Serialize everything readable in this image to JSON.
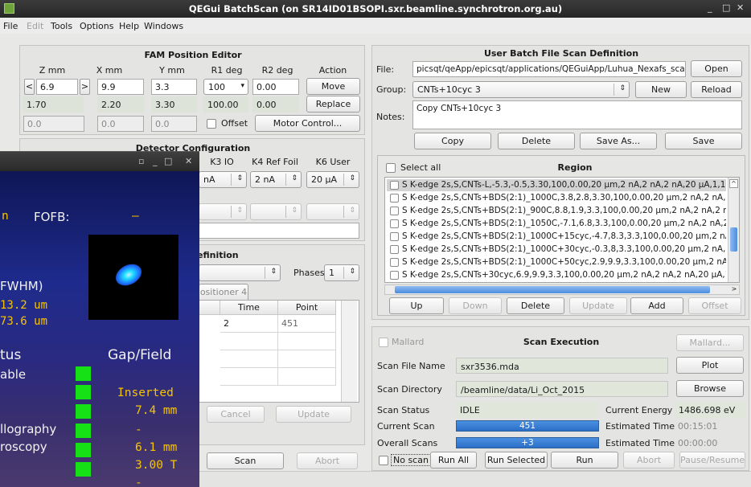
{
  "window": {
    "title": "QEGui BatchScan (on SR14ID01BSOPI.sxr.beamline.synchrotron.org.au)",
    "minimize": "_",
    "maximize": "□",
    "close": "✕"
  },
  "menu": [
    "File",
    "Edit",
    "Tools",
    "Options",
    "Help",
    "Windows"
  ],
  "fam": {
    "title": "FAM Position Editor",
    "headers": [
      "Z mm",
      "X mm",
      "Y mm",
      "R1 deg",
      "R2 deg",
      "Action"
    ],
    "z_input": "6.9",
    "x_input": "9.9",
    "y_input": "3.3",
    "r1_select": "100",
    "r2_input": "0.00",
    "move_label": "Move",
    "readback": [
      "1.70",
      "2.20",
      "3.30",
      "100.00",
      "0.00"
    ],
    "replace_label": "Replace",
    "disabled_values": [
      "0.0",
      "0.0",
      "0.0"
    ],
    "offset_label": "Offset",
    "motor_control_label": "Motor Control..."
  },
  "detector": {
    "title": "Detector Configuration",
    "headers": [
      "K3 IO",
      "K4 Ref Foil",
      "K6 User"
    ],
    "col0_value": "nA",
    "k4_value": "2 nA",
    "k6_value": "20 μA"
  },
  "scan_def": {
    "title_partial": "efinition",
    "phases_label": "Phases",
    "phases_value": "1",
    "tab_label": "ositioner 4",
    "table_headers": [
      "Time",
      "Point"
    ],
    "row_time": "2",
    "row_point": "451",
    "cancel_label": "Cancel",
    "update_label": "Update",
    "scan_label": "Scan",
    "abort_label": "Abort"
  },
  "batch": {
    "title": "User Batch File Scan Definition",
    "file_label": "File:",
    "file_value": "picsqt/qeApp/epicsqt/applications/QEGuiApp/Luhua_Nexafs_scans.xml",
    "open_label": "Open",
    "group_label": "Group:",
    "group_value": "CNTs+10cyc 3",
    "new_label": "New",
    "reload_label": "Reload",
    "notes_label": "Notes:",
    "notes_value": "Copy CNTs+10cyc 3",
    "copy_label": "Copy",
    "delete_label": "Delete",
    "save_as_label": "Save As...",
    "save_label": "Save",
    "select_all_label": "Select all",
    "region_label": "Region",
    "regions": [
      "S K-edge 2s,S,CNTs-L,-5.3,-0.5,3.30,100,0.00,20 μm,2 nA,2 nA,2 nA,20 μA,1,1",
      "S K-edge 2s,S,CNTs+BDS(2:1)_1000C,3.8,2.8,3.30,100,0.00,20 μm,2 nA,2 nA,2 nA,20 μ",
      "S K-edge 2s,S,CNTs+BDS(2:1)_900C,8.8,1.9,3.3,100,0.00,20 μm,2 nA,2 nA,2 nA,20 μA",
      "S K-edge 2s,S,CNTs+BDS(2:1)_1050C,-7.1,6.8,3.3,100,0.00,20 μm,2 nA,2 nA,2 nA,20 μ",
      "S K-edge 2s,S,CNTs+BDS(2:1)_1000C+15cyc,-4.7,8.3,3.3,100,0.00,20 μm,2 nA,2 nA,2 n",
      "S K-edge 2s,S,CNTs+BDS(2:1)_1000C+30cyc,-0.3,8,3.3,100,0.00,20 μm,2 nA,2 nA,2 n",
      "S K-edge 2s,S,CNTs+BDS(2:1)_1000C+50cyc,2.9,9.9,3.3,100,0.00,20 μm,2 nA,2 nA,2 n",
      "S K-edge 2s,S,CNTs+30cyc,6.9,9.9,3.3,100,0.00,20 μm,2 nA,2 nA,2 nA,20 μA,1,1"
    ],
    "up_label": "Up",
    "down_label": "Down",
    "delete2_label": "Delete",
    "update_label": "Update",
    "add_label": "Add",
    "offset_label": "Offset"
  },
  "execution": {
    "mallard_chk_label": "Mallard",
    "title": "Scan Execution",
    "mallard_btn_label": "Mallard...",
    "file_name_label": "Scan File Name",
    "file_name_value": "sxr3536.mda",
    "plot_label": "Plot",
    "directory_label": "Scan Directory",
    "directory_value": "/beamline/data/Li_Oct_2015",
    "browse_label": "Browse",
    "status_label": "Scan Status",
    "status_value": "IDLE",
    "energy_label": "Current Energy",
    "energy_value": "1486.698 eV",
    "current_scan_label": "Current Scan",
    "current_scan_value": "451",
    "est_time_label": "Estimated Time",
    "est_time_value": "00:15:01",
    "overall_label": "Overall Scans",
    "overall_value": "+3",
    "est_time2_label": "Estimated Time",
    "est_time2_value": "00:00:00",
    "no_scan_label": "No scan",
    "run_all_label": "Run All",
    "run_selected_label": "Run Selected",
    "run_unscanned_label": "Run Unscanned",
    "abort_label": "Abort",
    "pause_label": "Pause/Resume"
  },
  "overlay": {
    "fofb_n": "n",
    "fofb_label": "FOFB:",
    "fofb_value": "–",
    "fwhm_label": "FWHM)",
    "fwhm_v1": "13.2 um",
    "fwhm_v2": "73.6 um",
    "tus": "tus",
    "gap_field": "Gap/Field",
    "able": "able",
    "inserted": "Inserted",
    "gap_mm": "7.4 mm",
    "llography": "llography",
    "dash1": "-",
    "roscopy": "roscopy",
    "mm_6": "6.1 mm",
    "tesla": "3.00 T",
    "dash2": "-"
  }
}
